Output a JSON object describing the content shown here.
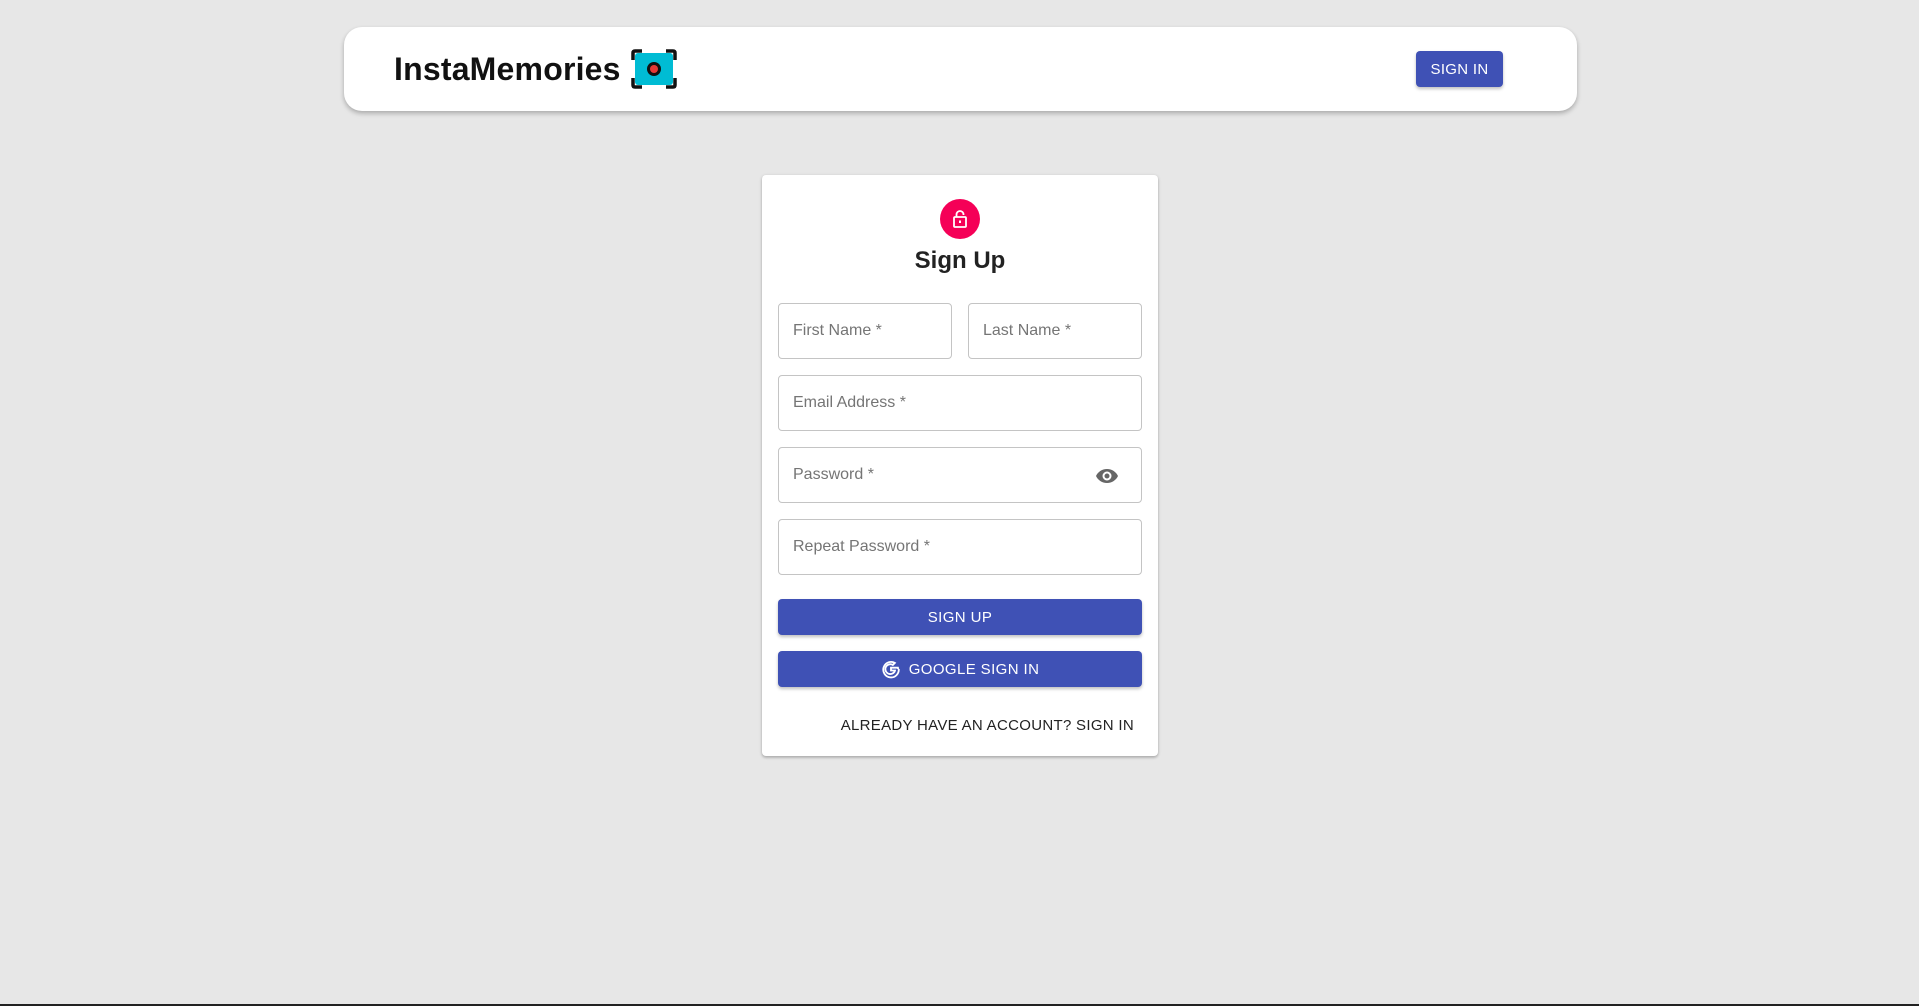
{
  "header": {
    "brand_title": "InstaMemories",
    "logo_icon": "camera-icon",
    "signin_label": "SIGN IN"
  },
  "form": {
    "avatar_icon": "lock-icon",
    "title": "Sign Up",
    "first_name_placeholder": "First Name *",
    "last_name_placeholder": "Last Name *",
    "email_placeholder": "Email Address *",
    "password_placeholder": "Password *",
    "password_toggle_icon": "eye-icon",
    "repeat_password_placeholder": "Repeat Password *",
    "signup_label": "SIGN UP",
    "google_icon": "google-icon",
    "google_label": "GOOGLE SIGN IN",
    "switch_label": "ALREADY HAVE AN ACCOUNT? SIGN IN"
  },
  "colors": {
    "background": "#e7e7e7",
    "primary": "#3f51b5",
    "avatar": "#f50057",
    "logo_accent": "#00bcd4"
  }
}
